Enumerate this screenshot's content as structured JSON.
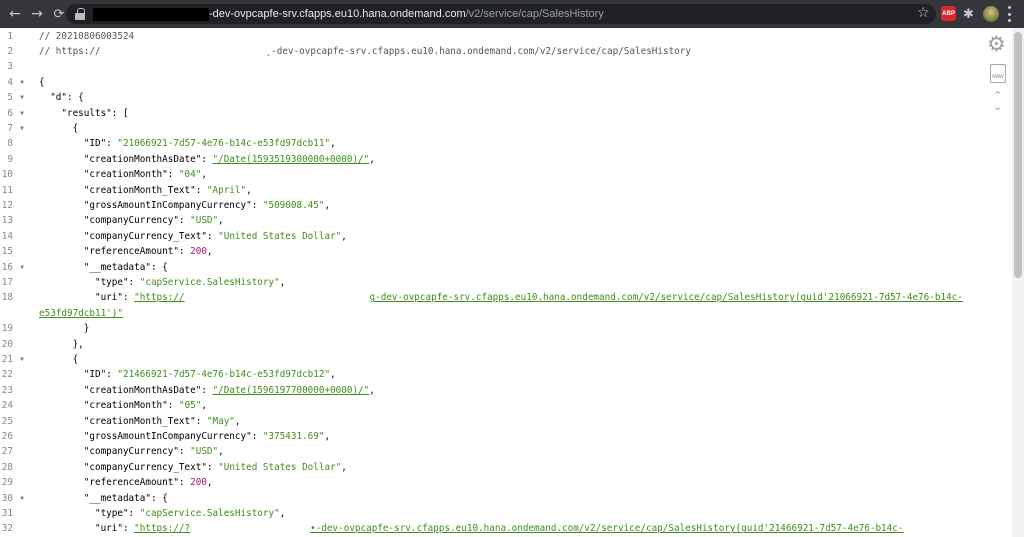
{
  "browser": {
    "url_host": "-dev-ovpcapfe-srv.cfapps.eu10.hana.ondemand.com",
    "url_path": "/v2/service/cap/SalesHistory",
    "nav_back": "←",
    "nav_forward": "→",
    "nav_reload": "⟳",
    "star": "☆",
    "ext_abp_label": "ABP",
    "puzzle": "✱",
    "icons": [
      "back-arrow-icon",
      "forward-arrow-icon",
      "reload-icon",
      "lock-icon",
      "star-icon",
      "adblock-icon",
      "puzzle-icon",
      "avatar-icon",
      "menu-dots-icon"
    ]
  },
  "tools": {
    "gear": "⚙",
    "raw_label": "RAW",
    "up": "⌃",
    "down": "⌄"
  },
  "lines": [
    {
      "n": "1",
      "fold": false,
      "text": [
        [
          "c",
          "// 20210806003524"
        ]
      ]
    },
    {
      "n": "2",
      "fold": false,
      "text": [
        [
          "c",
          "// https://"
        ],
        [
          "gap",
          165
        ],
        [
          "c",
          "¸-dev-ovpcapfe-srv.cfapps.eu10.hana.ondemand.com/v2/service/cap/SalesHistory"
        ]
      ]
    },
    {
      "n": "3",
      "fold": false,
      "text": []
    },
    {
      "n": "4",
      "fold": true,
      "text": [
        [
          "k",
          "{"
        ]
      ]
    },
    {
      "n": "5",
      "fold": true,
      "text": [
        [
          "k",
          "  \"d\": {"
        ]
      ]
    },
    {
      "n": "6",
      "fold": true,
      "text": [
        [
          "k",
          "    \"results\": ["
        ]
      ]
    },
    {
      "n": "7",
      "fold": true,
      "text": [
        [
          "k",
          "      {"
        ]
      ]
    },
    {
      "n": "8",
      "fold": false,
      "text": [
        [
          "k",
          "        \"ID\": "
        ],
        [
          "s",
          "\"21066921-7d57-4e76-b14c-e53fd97dcb11\""
        ],
        [
          "k",
          ","
        ]
      ]
    },
    {
      "n": "9",
      "fold": false,
      "text": [
        [
          "k",
          "        \"creationMonthAsDate\": "
        ],
        [
          "u",
          "\"/Date(1593519300000+0000)/\""
        ],
        [
          "k",
          ","
        ]
      ]
    },
    {
      "n": "10",
      "fold": false,
      "text": [
        [
          "k",
          "        \"creationMonth\": "
        ],
        [
          "s",
          "\"04\""
        ],
        [
          "k",
          ","
        ]
      ]
    },
    {
      "n": "11",
      "fold": false,
      "text": [
        [
          "k",
          "        \"creationMonth_Text\": "
        ],
        [
          "s",
          "\"April\""
        ],
        [
          "k",
          ","
        ]
      ]
    },
    {
      "n": "12",
      "fold": false,
      "text": [
        [
          "k",
          "        \"grossAmountInCompanyCurrency\": "
        ],
        [
          "s",
          "\"509008.45\""
        ],
        [
          "k",
          ","
        ]
      ]
    },
    {
      "n": "13",
      "fold": false,
      "text": [
        [
          "k",
          "        \"companyCurrency\": "
        ],
        [
          "s",
          "\"USD\""
        ],
        [
          "k",
          ","
        ]
      ]
    },
    {
      "n": "14",
      "fold": false,
      "text": [
        [
          "k",
          "        \"companyCurrency_Text\": "
        ],
        [
          "s",
          "\"United States Dollar\""
        ],
        [
          "k",
          ","
        ]
      ]
    },
    {
      "n": "15",
      "fold": false,
      "text": [
        [
          "k",
          "        \"referenceAmount\": "
        ],
        [
          "n",
          "200"
        ],
        [
          "k",
          ","
        ]
      ]
    },
    {
      "n": "16",
      "fold": true,
      "text": [
        [
          "k",
          "        \"__metadata\": {"
        ]
      ]
    },
    {
      "n": "17",
      "fold": false,
      "text": [
        [
          "k",
          "          \"type\": "
        ],
        [
          "s",
          "\"capService.SalesHistory\""
        ],
        [
          "k",
          ","
        ]
      ]
    },
    {
      "n": "18",
      "fold": false,
      "text": [
        [
          "k",
          "          \"uri\": "
        ],
        [
          "u",
          "\"https://"
        ],
        [
          "gap",
          185
        ],
        [
          "u",
          "g-dev-ovpcapfe-srv.cfapps.eu10.hana.ondemand.com/v2/service/cap/SalesHistory(guid'21066921-7d57-4e76-b14c-"
        ]
      ]
    },
    {
      "n": "",
      "fold": false,
      "cont": true,
      "text": [
        [
          "u",
          "e53fd97dcb11')\""
        ]
      ]
    },
    {
      "n": "19",
      "fold": false,
      "text": [
        [
          "k",
          "        }"
        ]
      ]
    },
    {
      "n": "20",
      "fold": false,
      "text": [
        [
          "k",
          "      },"
        ]
      ]
    },
    {
      "n": "21",
      "fold": true,
      "text": [
        [
          "k",
          "      {"
        ]
      ]
    },
    {
      "n": "22",
      "fold": false,
      "text": [
        [
          "k",
          "        \"ID\": "
        ],
        [
          "s",
          "\"21466921-7d57-4e76-b14c-e53fd97dcb12\""
        ],
        [
          "k",
          ","
        ]
      ]
    },
    {
      "n": "23",
      "fold": false,
      "text": [
        [
          "k",
          "        \"creationMonthAsDate\": "
        ],
        [
          "u",
          "\"/Date(1596197700000+0000)/\""
        ],
        [
          "k",
          ","
        ]
      ]
    },
    {
      "n": "24",
      "fold": false,
      "text": [
        [
          "k",
          "        \"creationMonth\": "
        ],
        [
          "s",
          "\"05\""
        ],
        [
          "k",
          ","
        ]
      ]
    },
    {
      "n": "25",
      "fold": false,
      "text": [
        [
          "k",
          "        \"creationMonth_Text\": "
        ],
        [
          "s",
          "\"May\""
        ],
        [
          "k",
          ","
        ]
      ]
    },
    {
      "n": "26",
      "fold": false,
      "text": [
        [
          "k",
          "        \"grossAmountInCompanyCurrency\": "
        ],
        [
          "s",
          "\"375431.69\""
        ],
        [
          "k",
          ","
        ]
      ]
    },
    {
      "n": "27",
      "fold": false,
      "text": [
        [
          "k",
          "        \"companyCurrency\": "
        ],
        [
          "s",
          "\"USD\""
        ],
        [
          "k",
          ","
        ]
      ]
    },
    {
      "n": "28",
      "fold": false,
      "text": [
        [
          "k",
          "        \"companyCurrency_Text\": "
        ],
        [
          "s",
          "\"United States Dollar\""
        ],
        [
          "k",
          ","
        ]
      ]
    },
    {
      "n": "29",
      "fold": false,
      "text": [
        [
          "k",
          "        \"referenceAmount\": "
        ],
        [
          "n",
          "200"
        ],
        [
          "k",
          ","
        ]
      ]
    },
    {
      "n": "30",
      "fold": true,
      "text": [
        [
          "k",
          "        \"__metadata\": {"
        ]
      ]
    },
    {
      "n": "31",
      "fold": false,
      "text": [
        [
          "k",
          "          \"type\": "
        ],
        [
          "s",
          "\"capService.SalesHistory\""
        ],
        [
          "k",
          ","
        ]
      ]
    },
    {
      "n": "32",
      "fold": false,
      "text": [
        [
          "k",
          "          \"uri\": "
        ],
        [
          "u",
          "\"https://?"
        ],
        [
          "gap",
          120
        ],
        [
          "u",
          "•-dev-ovpcapfe-srv.cfapps.eu10.hana.ondemand.com/v2/service/cap/SalesHistory(guid'21466921-7d57-4e76-b14c-"
        ]
      ]
    }
  ]
}
